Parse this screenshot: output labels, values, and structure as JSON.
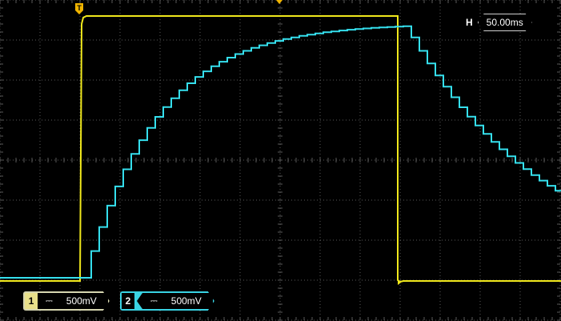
{
  "timebase": {
    "label": "H",
    "value": "50.00ms"
  },
  "trigger": {
    "marker": "T"
  },
  "channels": [
    {
      "number": "1",
      "coupling": "⎓",
      "scale": "500mV",
      "color": "#f0e81c"
    },
    {
      "number": "2",
      "coupling": "⎓",
      "scale": "500mV",
      "color": "#35e0ee"
    }
  ],
  "colors": {
    "grid": "#5a5a5a",
    "ch1": "#f0e81c",
    "ch2": "#35e0ee",
    "trigger": "#f0b400"
  }
}
